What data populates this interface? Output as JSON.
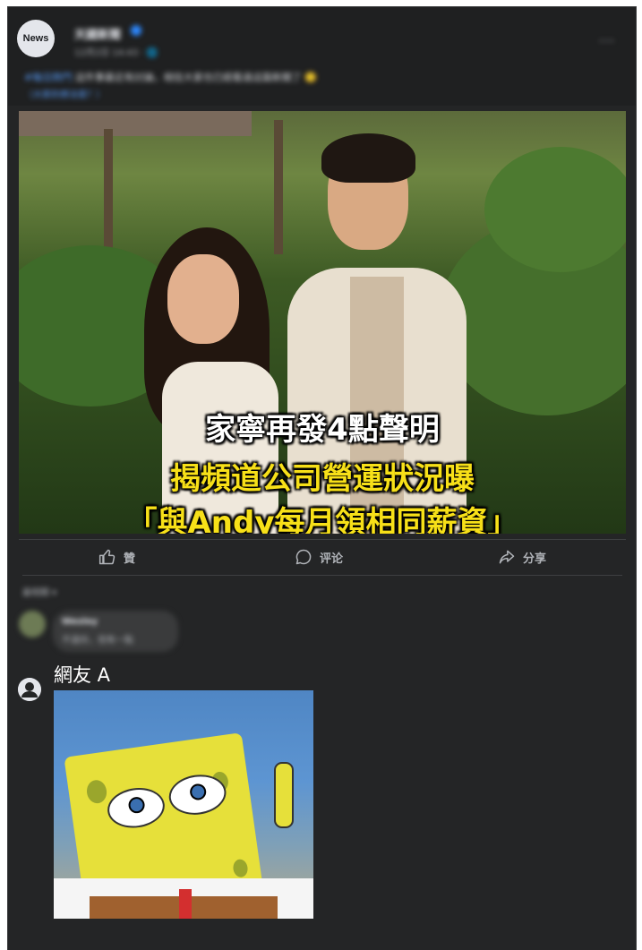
{
  "post": {
    "avatar_text": "News",
    "page_name": "天國新聞",
    "meta": "12月2日 14:43 · 🌐",
    "more": "···",
    "caption_tag": "#每日熱門",
    "caption_text": "這件事最近有討論，相信大家也已經看過這篇新聞了 🙂",
    "caption_link": "（大家的想法是？）",
    "image": {
      "headline_1": "家寧再發4點聲明",
      "headline_2": "揭頻道公司營運狀況曝",
      "headline_3": "「與Andy每月領相同薪資」"
    }
  },
  "actions": {
    "like": "贊",
    "comment": "评论",
    "share": "分享"
  },
  "comments": {
    "sort_label": "最相關 ▾",
    "first": {
      "name": "Wesley",
      "text": "不過份，但有一點"
    },
    "second": {
      "name": "網友 A"
    }
  },
  "colors": {
    "card_bg": "#242526",
    "headline_white": "#ffffff",
    "headline_yellow": "#f7e018",
    "muted_text": "#b0b3b8"
  }
}
